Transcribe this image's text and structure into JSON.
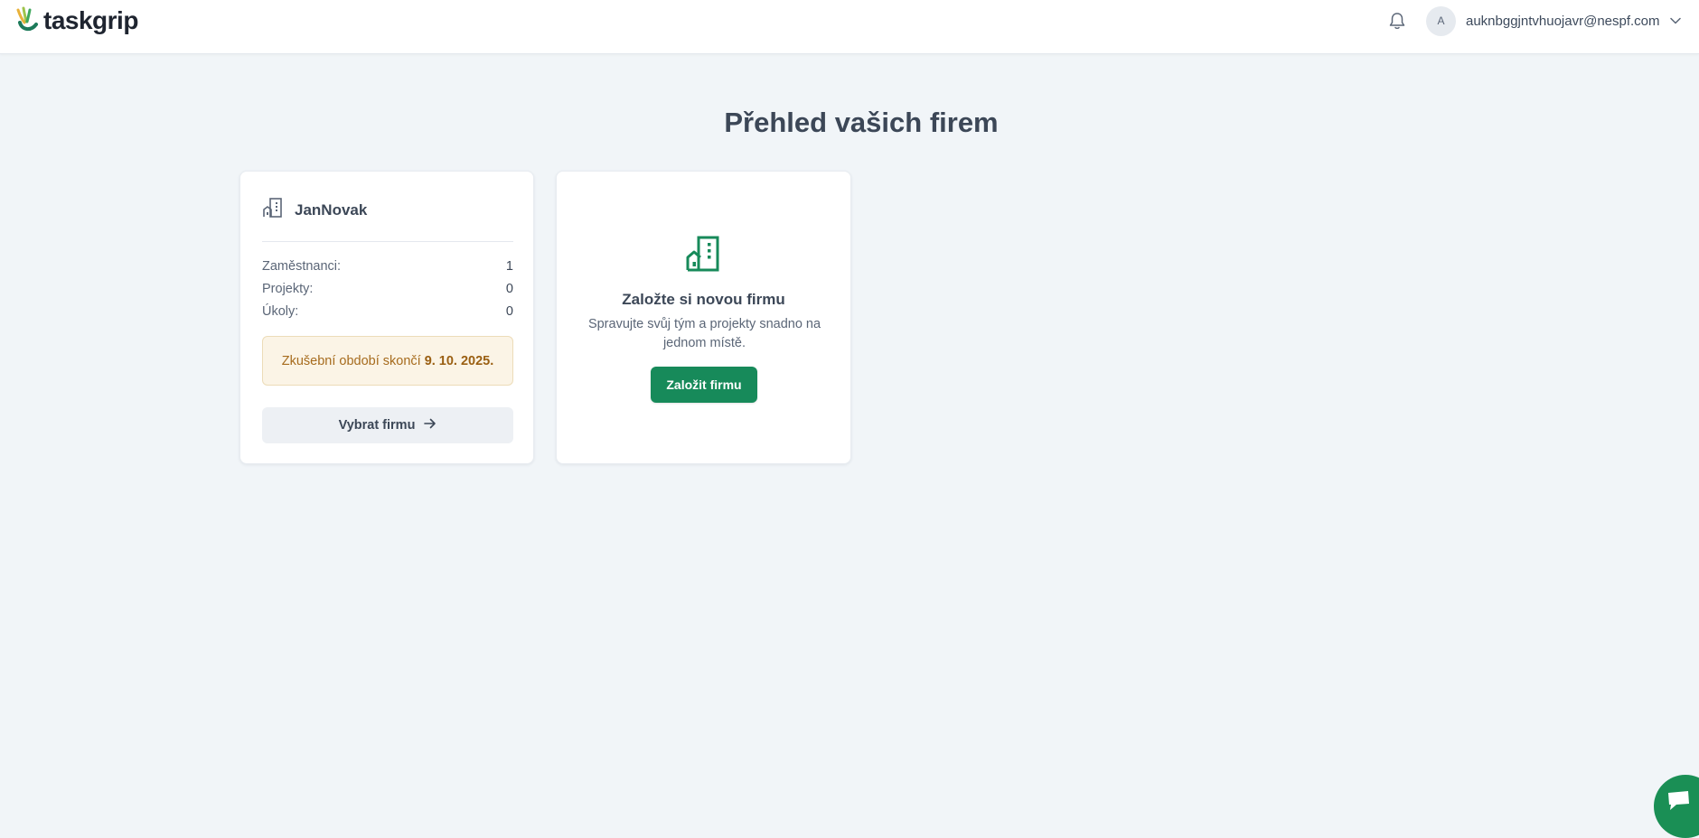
{
  "header": {
    "logo_text": "taskgrip",
    "user_avatar_initial": "A",
    "user_email": "auknbggjntvhuojavr@nespf.com"
  },
  "page": {
    "title": "Přehled vašich firem"
  },
  "company_card": {
    "name": "JanNovak",
    "stats": [
      {
        "label": "Zaměstnanci:",
        "value": "1"
      },
      {
        "label": "Projekty:",
        "value": "0"
      },
      {
        "label": "Úkoly:",
        "value": "0"
      }
    ],
    "trial_text": "Zkušební období skončí",
    "trial_date": "9. 10. 2025.",
    "select_button": "Vybrat firmu"
  },
  "new_company_card": {
    "title": "Založte si novou firmu",
    "description": "Spravujte svůj tým a projekty snadno na jednom místě.",
    "create_button": "Založit firmu"
  },
  "colors": {
    "brand_green": "#178a5a",
    "trial_bg": "#fbf4e6",
    "trial_text": "#a66b1d",
    "page_bg": "#f1f5f8"
  }
}
